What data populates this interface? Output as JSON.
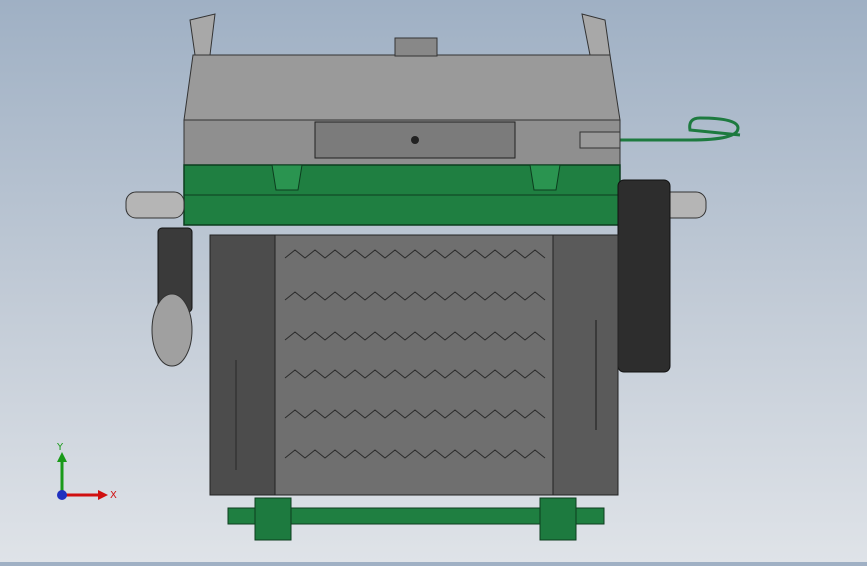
{
  "viewport": {
    "background_top": "#9fb0c4",
    "background_bottom": "#dfe3e8",
    "machine_green": "#1d7a3f",
    "machine_gray": "#8c8c8c"
  },
  "triad": {
    "x_label": "X",
    "y_label": "Y",
    "x_color": "#d01010",
    "y_color": "#1a9a1a",
    "z_color": "#2030c0"
  }
}
